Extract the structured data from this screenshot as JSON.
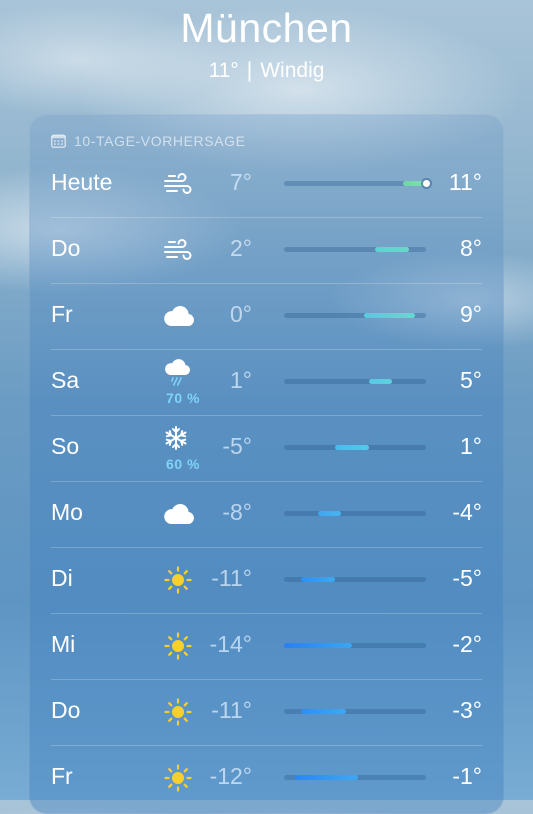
{
  "location": {
    "city": "München",
    "temp": "11°",
    "separator": "|",
    "condition": "Windig"
  },
  "forecast": {
    "title": "10-TAGE-VORHERSAGE",
    "scale_min": -14,
    "scale_max": 11,
    "days": [
      {
        "day": "Heute",
        "icon": "wind-icon",
        "precip": "",
        "low": "7°",
        "high": "11°",
        "low_v": 7,
        "high_v": 11,
        "current_v": 11,
        "color_from": "#6fd6a4",
        "color_to": "#7edfb7"
      },
      {
        "day": "Do",
        "icon": "wind-icon",
        "precip": "",
        "low": "2°",
        "high": "8°",
        "low_v": 2,
        "high_v": 8,
        "color_from": "#5ed1d3",
        "color_to": "#6ad7c9"
      },
      {
        "day": "Fr",
        "icon": "cloud-icon",
        "precip": "",
        "low": "0°",
        "high": "9°",
        "low_v": 0,
        "high_v": 9,
        "color_from": "#55cbe0",
        "color_to": "#67d7d0"
      },
      {
        "day": "Sa",
        "icon": "rain-icon",
        "precip": "70 %",
        "low": "1°",
        "high": "5°",
        "low_v": 1,
        "high_v": 5,
        "color_from": "#58c9e4",
        "color_to": "#5ed0dc"
      },
      {
        "day": "So",
        "icon": "snowflake-icon",
        "precip": "60 %",
        "low": "-5°",
        "high": "1°",
        "low_v": -5,
        "high_v": 1,
        "color_from": "#4bb9ee",
        "color_to": "#56c8e6"
      },
      {
        "day": "Mo",
        "icon": "cloud-icon",
        "precip": "",
        "low": "-8°",
        "high": "-4°",
        "low_v": -8,
        "high_v": -4,
        "color_from": "#3fa6f0",
        "color_to": "#47b4ef"
      },
      {
        "day": "Di",
        "icon": "sun-icon",
        "precip": "",
        "low": "-11°",
        "high": "-5°",
        "low_v": -11,
        "high_v": -5,
        "color_from": "#2f90f2",
        "color_to": "#3fa8f0"
      },
      {
        "day": "Mi",
        "icon": "sun-icon",
        "precip": "",
        "low": "-14°",
        "high": "-2°",
        "low_v": -14,
        "high_v": -2,
        "color_from": "#2a7ff4",
        "color_to": "#3aa6f0"
      },
      {
        "day": "Do",
        "icon": "sun-icon",
        "precip": "",
        "low": "-11°",
        "high": "-3°",
        "low_v": -11,
        "high_v": -3,
        "color_from": "#2f8ef2",
        "color_to": "#3fa8f0"
      },
      {
        "day": "Fr",
        "icon": "sun-icon",
        "precip": "",
        "low": "-12°",
        "high": "-1°",
        "low_v": -12,
        "high_v": -1,
        "color_from": "#2c86f3",
        "color_to": "#3ea8f0"
      }
    ]
  }
}
